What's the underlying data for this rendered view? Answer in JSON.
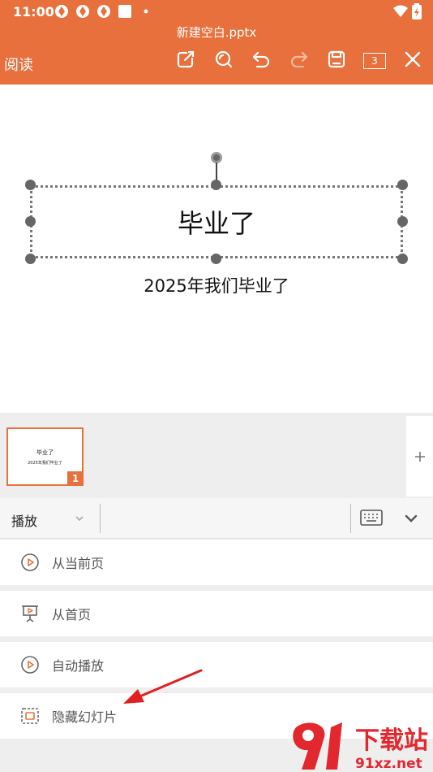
{
  "status_bar": {
    "time": "11:00"
  },
  "header": {
    "file_title": "新建空白.pptx",
    "read_label": "阅读",
    "page_count": "3"
  },
  "slide": {
    "title": "毕业了",
    "subtitle": "2025年我们毕业了"
  },
  "thumbnail": {
    "title": "毕业了",
    "subtitle": "2025年我们毕业了",
    "number": "1"
  },
  "ribbon": {
    "active_tab": "播放"
  },
  "menu": {
    "items": [
      {
        "label": "从当前页",
        "icon": "play-circle-icon"
      },
      {
        "label": "从首页",
        "icon": "projector-icon"
      },
      {
        "label": "自动播放",
        "icon": "play-circle-icon"
      },
      {
        "label": "隐藏幻灯片",
        "icon": "hidden-slide-icon"
      }
    ]
  },
  "watermark": {
    "brand_text": "下载站",
    "url_text": "91xz.net"
  },
  "colors": {
    "accent": "#e7703d",
    "arrow": "#e02020"
  }
}
